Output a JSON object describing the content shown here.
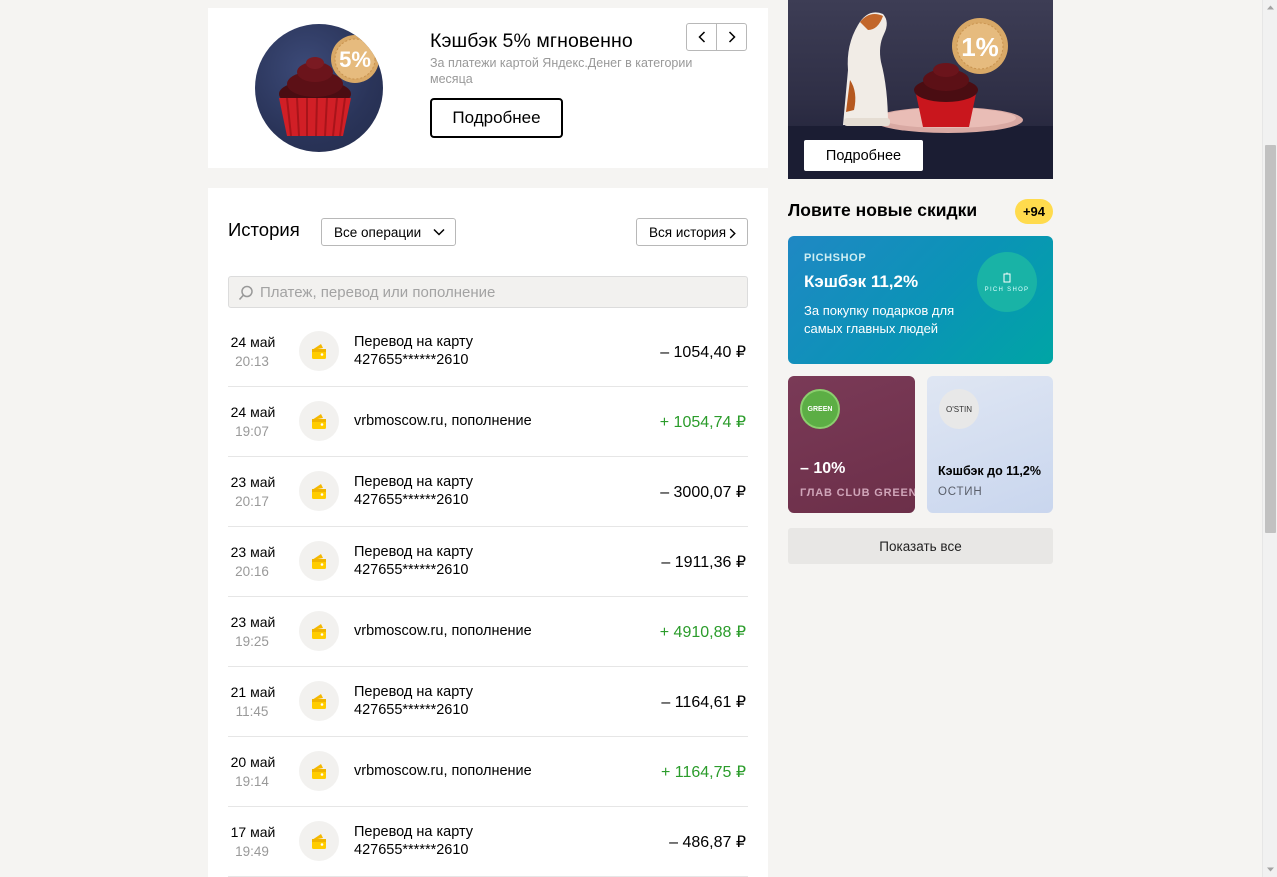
{
  "promo": {
    "title": "Кэшбэк 5% мгновенно",
    "description": "За платежи картой Яндекс.Денег в категории месяца",
    "button_label": "Подробнее",
    "badge_text": "5%"
  },
  "history": {
    "title": "История",
    "filter_value": "Все операции",
    "all_history_label": "Вся история",
    "search_placeholder": "Платеж, перевод или пополнение",
    "rows": [
      {
        "date": "24 май",
        "time": "20:13",
        "name": "Перевод на карту",
        "detail": "427655******2610",
        "amount": "– 1054,40 ₽",
        "positive": false
      },
      {
        "date": "24 май",
        "time": "19:07",
        "name": "vrbmoscow.ru, пополнение",
        "detail": "",
        "amount": "+ 1054,74 ₽",
        "positive": true
      },
      {
        "date": "23 май",
        "time": "20:17",
        "name": "Перевод на карту",
        "detail": "427655******2610",
        "amount": "– 3000,07 ₽",
        "positive": false
      },
      {
        "date": "23 май",
        "time": "20:16",
        "name": "Перевод на карту",
        "detail": "427655******2610",
        "amount": "– 1911,36 ₽",
        "positive": false
      },
      {
        "date": "23 май",
        "time": "19:25",
        "name": "vrbmoscow.ru, пополнение",
        "detail": "",
        "amount": "+ 4910,88 ₽",
        "positive": true
      },
      {
        "date": "21 май",
        "time": "11:45",
        "name": "Перевод на карту",
        "detail": "427655******2610",
        "amount": "– 1164,61 ₽",
        "positive": false
      },
      {
        "date": "20 май",
        "time": "19:14",
        "name": "vrbmoscow.ru, пополнение",
        "detail": "",
        "amount": "+ 1164,75 ₽",
        "positive": true
      },
      {
        "date": "17 май",
        "time": "19:49",
        "name": "Перевод на карту",
        "detail": "427655******2610",
        "amount": "– 486,87 ₽",
        "positive": false
      }
    ]
  },
  "right_banner": {
    "badge_text": "1%",
    "button_label": "Подробнее"
  },
  "deals": {
    "title": "Ловите новые скидки",
    "badge": "+94",
    "pichshop": {
      "brand": "PICHSHOP",
      "title": "Кэшбэк 11,2%",
      "description": "За покупку подарков для самых главных людей",
      "logo_text": "PICH SHOP"
    },
    "glav": {
      "title": "– 10%",
      "name": "ГЛАВ CLUB GREEN",
      "logo_text": "GREEN"
    },
    "ostin": {
      "title": "Кэшбэк до 11,2%",
      "name": "ОСТИН",
      "logo_text": "O'STIN"
    },
    "show_all_label": "Показать все"
  },
  "colors": {
    "accent_yellow": "#ffdb4d",
    "positive_green": "#2b9c2b",
    "page_bg": "#f5f4f2"
  }
}
